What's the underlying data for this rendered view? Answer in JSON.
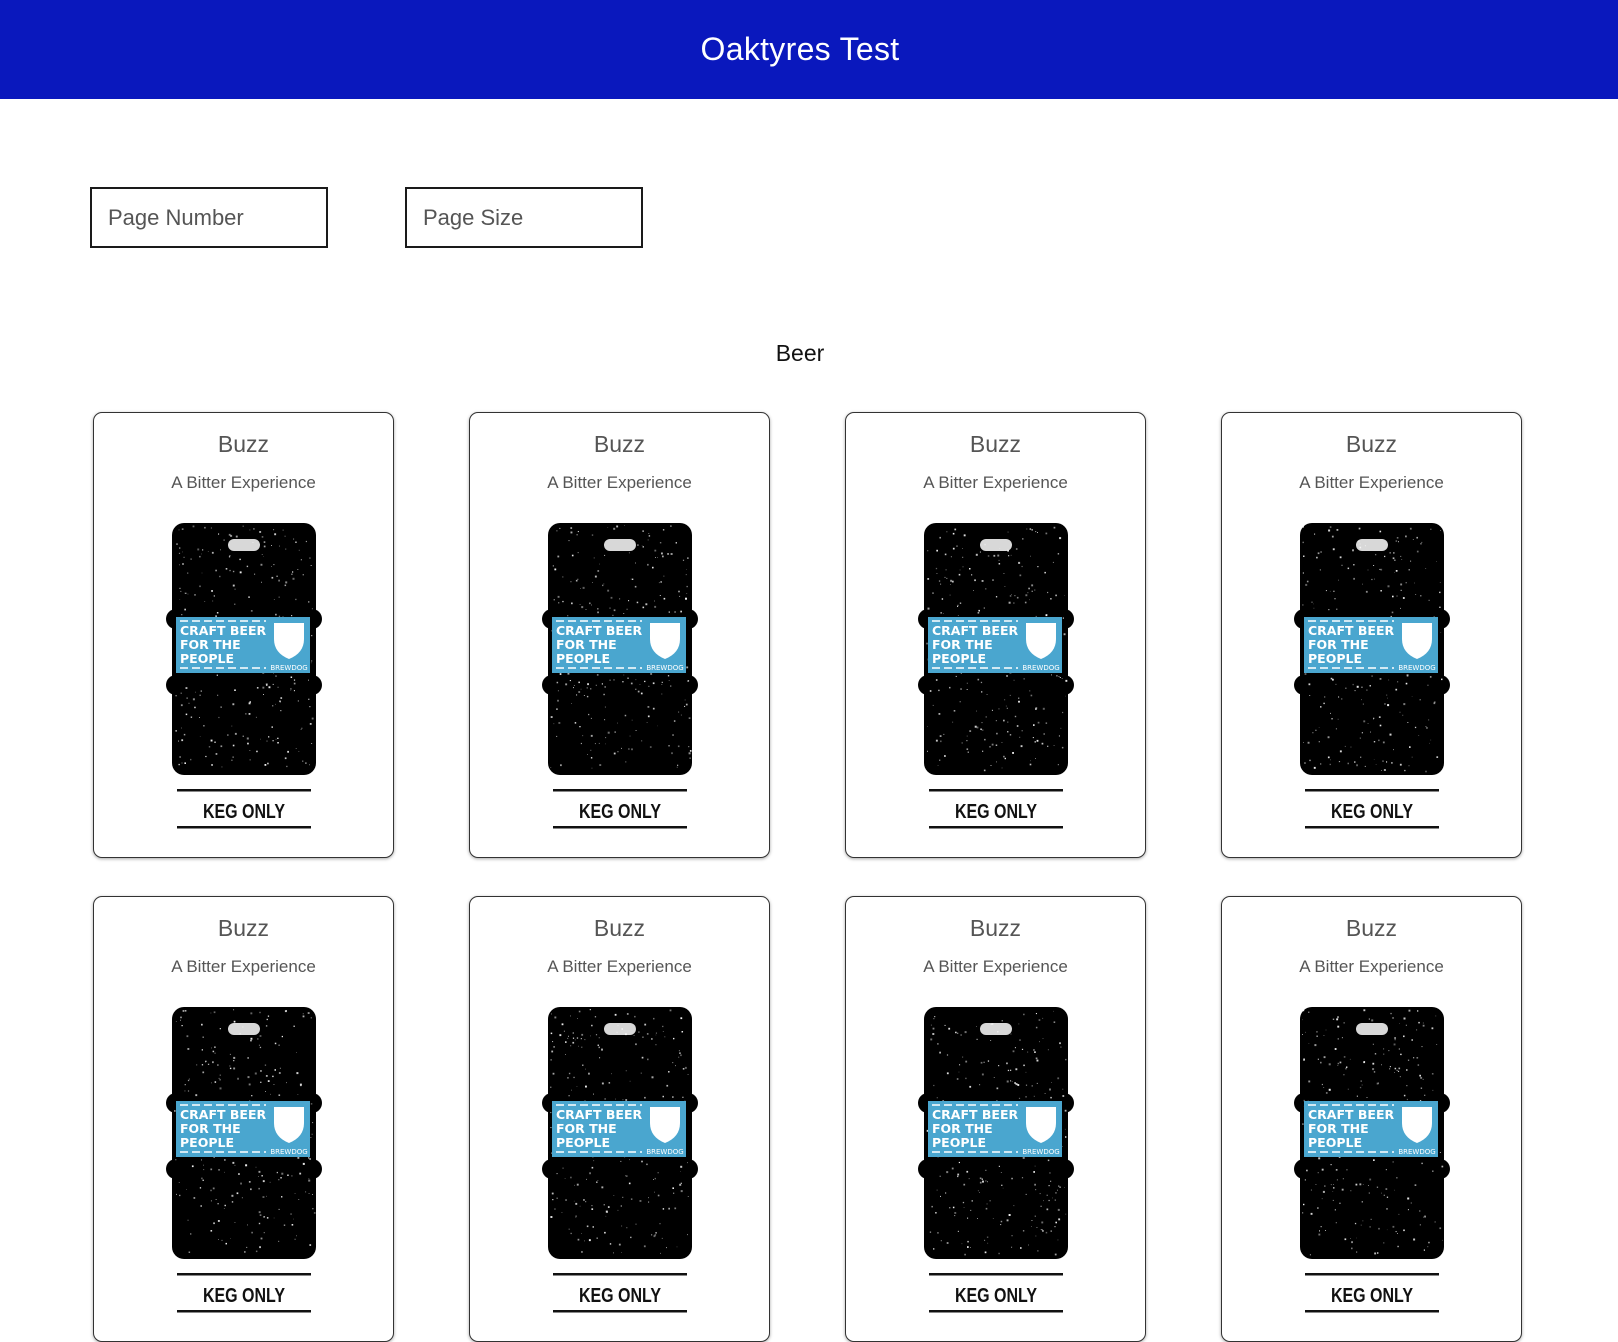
{
  "app": {
    "title": "Oaktyres Test"
  },
  "filters": {
    "page_number_placeholder": "Page Number",
    "page_size_placeholder": "Page Size"
  },
  "section": {
    "title": "Beer"
  },
  "beers": [
    {
      "name": "Buzz",
      "tagline": "A Bitter Experience",
      "image": {
        "label_text": [
          "CRAFT BEER",
          "FOR THE",
          "PEOPLE"
        ],
        "brand": "BREWDOG",
        "footer": "KEG ONLY"
      }
    },
    {
      "name": "Buzz",
      "tagline": "A Bitter Experience",
      "image": {
        "label_text": [
          "CRAFT BEER",
          "FOR THE",
          "PEOPLE"
        ],
        "brand": "BREWDOG",
        "footer": "KEG ONLY"
      }
    },
    {
      "name": "Buzz",
      "tagline": "A Bitter Experience",
      "image": {
        "label_text": [
          "CRAFT BEER",
          "FOR THE",
          "PEOPLE"
        ],
        "brand": "BREWDOG",
        "footer": "KEG ONLY"
      }
    },
    {
      "name": "Buzz",
      "tagline": "A Bitter Experience",
      "image": {
        "label_text": [
          "CRAFT BEER",
          "FOR THE",
          "PEOPLE"
        ],
        "brand": "BREWDOG",
        "footer": "KEG ONLY"
      }
    },
    {
      "name": "Buzz",
      "tagline": "A Bitter Experience",
      "image": {
        "label_text": [
          "CRAFT BEER",
          "FOR THE",
          "PEOPLE"
        ],
        "brand": "BREWDOG",
        "footer": "KEG ONLY"
      }
    },
    {
      "name": "Buzz",
      "tagline": "A Bitter Experience",
      "image": {
        "label_text": [
          "CRAFT BEER",
          "FOR THE",
          "PEOPLE"
        ],
        "brand": "BREWDOG",
        "footer": "KEG ONLY"
      }
    },
    {
      "name": "Buzz",
      "tagline": "A Bitter Experience",
      "image": {
        "label_text": [
          "CRAFT BEER",
          "FOR THE",
          "PEOPLE"
        ],
        "brand": "BREWDOG",
        "footer": "KEG ONLY"
      }
    },
    {
      "name": "Buzz",
      "tagline": "A Bitter Experience",
      "image": {
        "label_text": [
          "CRAFT BEER",
          "FOR THE",
          "PEOPLE"
        ],
        "brand": "BREWDOG",
        "footer": "KEG ONLY"
      }
    }
  ],
  "colors": {
    "header_bg": "#0a18bd",
    "header_text": "#ffffff",
    "keg_body": "#000000",
    "keg_label": "#4aa6cf"
  }
}
